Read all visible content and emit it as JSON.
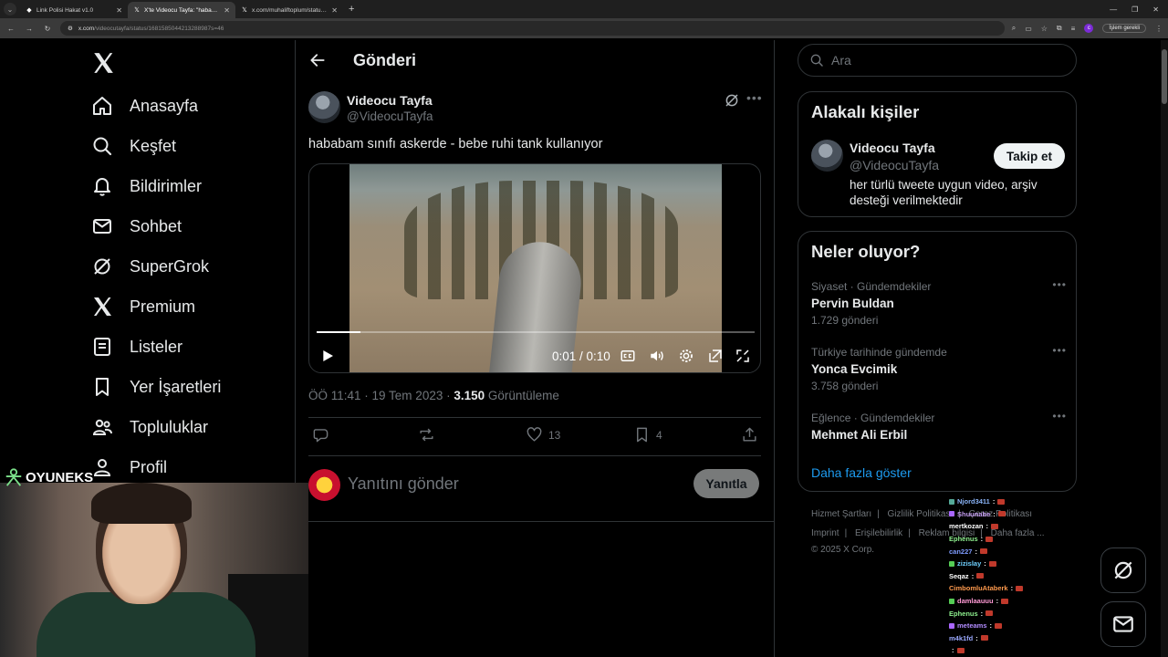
{
  "browser": {
    "tabs": [
      {
        "title": "Link Polisi Hakat v1.0",
        "active": false
      },
      {
        "title": "X'te Videocu Tayfa: \"hababam ...",
        "active": true
      },
      {
        "title": "x.com/muhaliftoplum/status/1...",
        "active": false
      }
    ],
    "url_host": "x.com",
    "url_path": "/videocutayfa/status/1681585044213288987s=46",
    "profile_initial": "c",
    "update_label": "İşlem gerekli"
  },
  "nav": {
    "items": [
      {
        "label": "Anasayfa",
        "icon": "home-icon"
      },
      {
        "label": "Keşfet",
        "icon": "search-icon"
      },
      {
        "label": "Bildirimler",
        "icon": "bell-icon"
      },
      {
        "label": "Sohbet",
        "icon": "mail-icon"
      },
      {
        "label": "SuperGrok",
        "icon": "grok-icon"
      },
      {
        "label": "Premium",
        "icon": "x-logo-icon"
      },
      {
        "label": "Listeler",
        "icon": "list-icon"
      },
      {
        "label": "Yer İşaretleri",
        "icon": "bookmark-icon"
      },
      {
        "label": "Topluluklar",
        "icon": "communities-icon"
      },
      {
        "label": "Profil",
        "icon": "profile-icon"
      }
    ]
  },
  "post": {
    "page_title": "Gönderi",
    "author_name": "Videocu Tayfa",
    "author_handle": "@VideocuTayfa",
    "text": "hababam sınıfı askerde - bebe ruhi tank kullanıyor",
    "video_time": "0:01 / 0:10",
    "video_progress": 0.1,
    "timestamp": "ÖÖ 11:41 · 19 Tem 2023 · ",
    "views_count": "3.150",
    "views_label": " Görüntüleme",
    "likes": "13",
    "bookmarks": "4",
    "reply_placeholder": "Yanıtını gönder",
    "reply_button": "Yanıtla"
  },
  "sidebar": {
    "search_placeholder": "Ara",
    "related_title": "Alakalı kişiler",
    "related": {
      "name": "Videocu Tayfa",
      "handle": "@VideocuTayfa",
      "follow_label": "Takip et",
      "bio": "her türlü tweete uygun video, arşiv desteği verilmektedir"
    },
    "trends_title": "Neler oluyor?",
    "trends": [
      {
        "context": "Siyaset · Gündemdekiler",
        "title": "Pervin Buldan",
        "count": "1.729 gönderi"
      },
      {
        "context": "Türkiye tarihinde gündemde",
        "title": "Yonca Evcimik",
        "count": "3.758 gönderi"
      },
      {
        "context": "Eğlence · Gündemdekiler",
        "title": "Mehmet Ali Erbil",
        "count": ""
      }
    ],
    "show_more": "Daha fazla göster",
    "footer": {
      "line1": [
        "Hizmet Şartları",
        "Gizlilik Politikası",
        "Çerez Politikası"
      ],
      "line2": [
        "Imprint",
        "Erişilebilirlik",
        "Reklam bilgisi",
        "Daha fazla ..."
      ],
      "copyright": "© 2025 X Corp."
    }
  },
  "overlay": {
    "logo_text": "OYUNEKS",
    "chat": [
      {
        "user": "Njord3411",
        "color": "#8ab4f8",
        "badge": "#5a9"
      },
      {
        "user": "Shuunabe",
        "color": "#c39bf0",
        "badge": "#a6f"
      },
      {
        "user": "mertkozan",
        "color": "#ffffff",
        "badge": ""
      },
      {
        "user": "Ephenus",
        "color": "#8ef08e",
        "badge": ""
      },
      {
        "user": "can227",
        "color": "#7f9cff",
        "badge": ""
      },
      {
        "user": "zizislay",
        "color": "#6fd0ff",
        "badge": "#5c5"
      },
      {
        "user": "Seqaz",
        "color": "#ffffff",
        "badge": ""
      },
      {
        "user": "CimbomluAtaberk",
        "color": "#ff9a4d",
        "badge": ""
      },
      {
        "user": "damlaauuu",
        "color": "#ff9ad5",
        "badge": "#5c5"
      },
      {
        "user": "Ephenus",
        "color": "#8ef08e",
        "badge": ""
      },
      {
        "user": "meteams",
        "color": "#b28cff",
        "badge": "#a6f"
      },
      {
        "user": "m4k1fd",
        "color": "#9aa8ff",
        "badge": ""
      },
      {
        "user": "",
        "color": "#ffffff",
        "badge": ""
      }
    ]
  },
  "colors": {
    "accent": "#1d9bf0",
    "background": "#000000",
    "border": "#2f3336",
    "muted": "#71767b"
  }
}
